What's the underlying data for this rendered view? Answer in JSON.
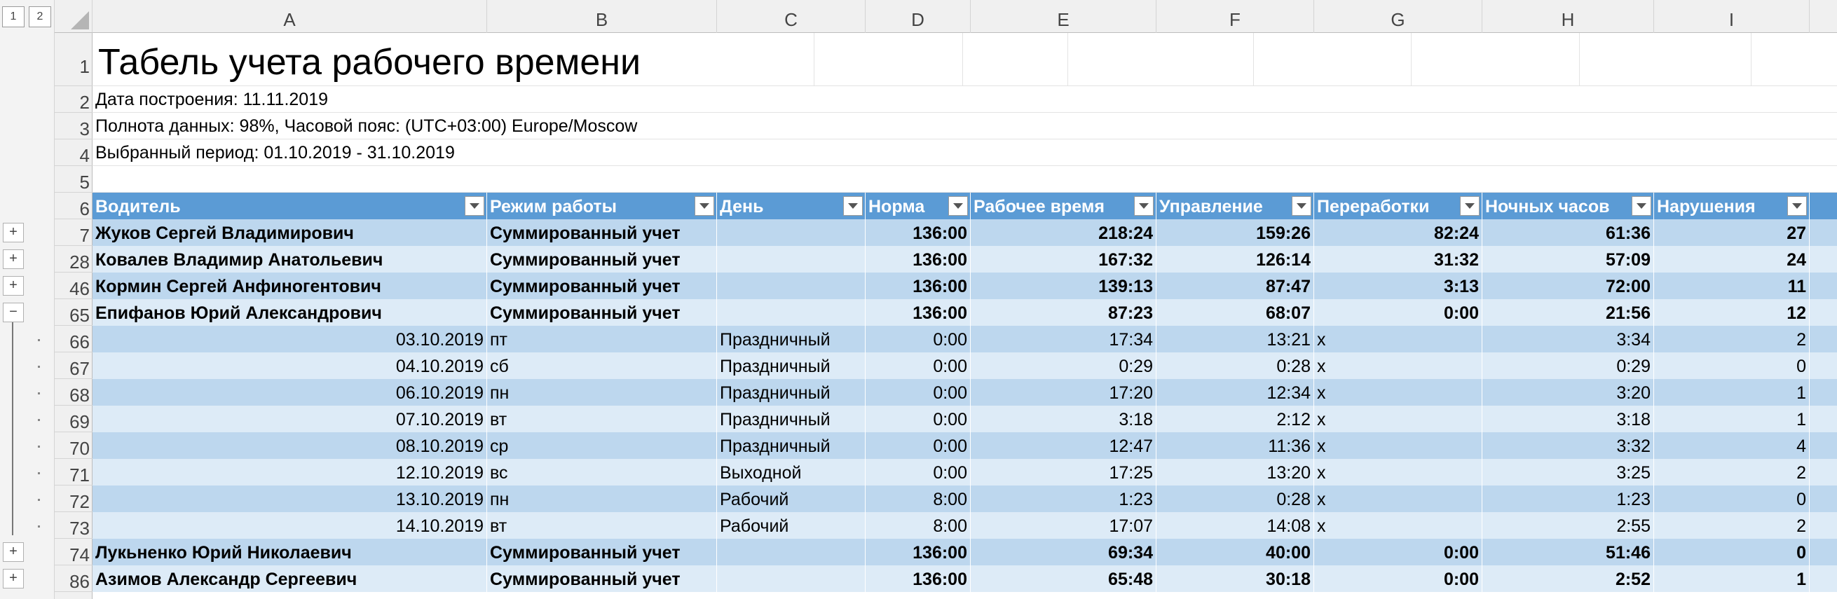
{
  "outline": {
    "levels": [
      "1",
      "2"
    ],
    "expand_symbol": "+",
    "collapse_symbol": "−"
  },
  "columns": [
    "A",
    "B",
    "C",
    "D",
    "E",
    "F",
    "G",
    "H",
    "I"
  ],
  "sheet": {
    "title": "Табель учета рабочего времени",
    "info": [
      "Дата построения: 11.11.2019",
      "Полнота данных: 98%, Часовой пояс: (UTC+03:00) Europe/Moscow",
      "Выбранный период: 01.10.2019 - 31.10.2019"
    ],
    "meta_row_numbers": [
      "1",
      "2",
      "3",
      "4",
      "5"
    ],
    "header_row_number": "6",
    "table_headers": [
      "Водитель",
      "Режим работы",
      "День",
      "Норма",
      "Рабочее время",
      "Управление",
      "Переработки",
      "Ночных часов",
      "Нарушения"
    ],
    "rows": [
      {
        "n": "7",
        "cells": [
          "Жуков Сергей Владимирович",
          "Суммированный учет",
          "",
          "136:00",
          "218:24",
          "159:26",
          "82:24",
          "61:36",
          "27"
        ]
      },
      {
        "n": "28",
        "cells": [
          "Ковалев Владимир Анатольевич",
          "Суммированный учет",
          "",
          "136:00",
          "167:32",
          "126:14",
          "31:32",
          "57:09",
          "24"
        ]
      },
      {
        "n": "46",
        "cells": [
          "Кормин Сергей Анфиногентович",
          "Суммированный учет",
          "",
          "136:00",
          "139:13",
          "87:47",
          "3:13",
          "72:00",
          "11"
        ]
      },
      {
        "n": "65",
        "cells": [
          "Епифанов Юрий Александрович",
          "Суммированный учет",
          "",
          "136:00",
          "87:23",
          "68:07",
          "0:00",
          "21:56",
          "12"
        ]
      },
      {
        "n": "66",
        "cells": [
          "03.10.2019",
          "пт",
          "Праздничный",
          "0:00",
          "17:34",
          "13:21",
          "x",
          "3:34",
          "2"
        ]
      },
      {
        "n": "67",
        "cells": [
          "04.10.2019",
          "сб",
          "Праздничный",
          "0:00",
          "0:29",
          "0:28",
          "x",
          "0:29",
          "0"
        ]
      },
      {
        "n": "68",
        "cells": [
          "06.10.2019",
          "пн",
          "Праздничный",
          "0:00",
          "17:20",
          "12:34",
          "x",
          "3:20",
          "1"
        ]
      },
      {
        "n": "69",
        "cells": [
          "07.10.2019",
          "вт",
          "Праздничный",
          "0:00",
          "3:18",
          "2:12",
          "x",
          "3:18",
          "1"
        ]
      },
      {
        "n": "70",
        "cells": [
          "08.10.2019",
          "ср",
          "Праздничный",
          "0:00",
          "12:47",
          "11:36",
          "x",
          "3:32",
          "4"
        ]
      },
      {
        "n": "71",
        "cells": [
          "12.10.2019",
          "вс",
          "Выходной",
          "0:00",
          "17:25",
          "13:20",
          "x",
          "3:25",
          "2"
        ]
      },
      {
        "n": "72",
        "cells": [
          "13.10.2019",
          "пн",
          "Рабочий",
          "8:00",
          "1:23",
          "0:28",
          "x",
          "1:23",
          "0"
        ]
      },
      {
        "n": "73",
        "cells": [
          "14.10.2019",
          "вт",
          "Рабочий",
          "8:00",
          "17:07",
          "14:08",
          "x",
          "2:55",
          "2"
        ]
      },
      {
        "n": "74",
        "cells": [
          "Лукьненко Юрий Николаевич",
          "Суммированный учет",
          "",
          "136:00",
          "69:34",
          "40:00",
          "0:00",
          "51:46",
          "0"
        ]
      },
      {
        "n": "86",
        "cells": [
          "Азимов Александр Сергеевич",
          "Суммированный учет",
          "",
          "136:00",
          "65:48",
          "30:18",
          "0:00",
          "2:52",
          "1"
        ]
      }
    ]
  }
}
